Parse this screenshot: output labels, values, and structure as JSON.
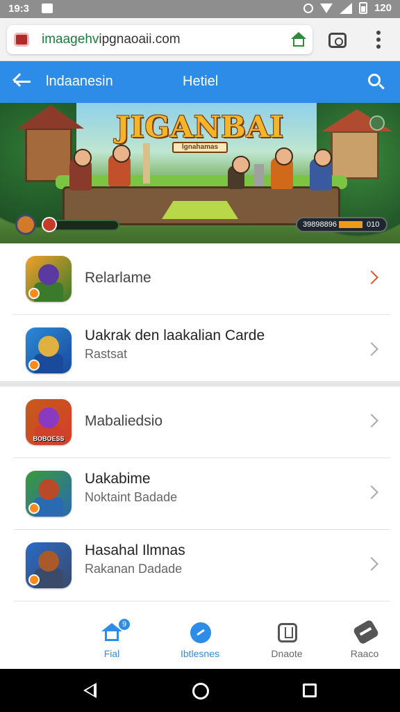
{
  "status_bar": {
    "time": "19:3",
    "battery_text": "120"
  },
  "browser": {
    "url_highlight": "imaagehv",
    "url_rest": "ipgnaoaii.com"
  },
  "app_bar": {
    "left_title": "lndaanesin",
    "center_title": "Hetiel"
  },
  "banner": {
    "game_title": "JIGANBAI",
    "game_subtitle": "lgnahamas",
    "hud_health_fraction": 0.55,
    "hud_health_text": "10",
    "hud_score": "39898896",
    "hud_meter_value": "010"
  },
  "list_section_1": [
    {
      "title": "Relarlame",
      "subtitle": "",
      "thumb_label": "",
      "active": true
    },
    {
      "title": "Uakrak den laakalian Carde",
      "subtitle": "Rastsat",
      "thumb_label": "",
      "active": false
    }
  ],
  "list_section_2": [
    {
      "title": "Mabaliedsio",
      "subtitle": "",
      "thumb_label": "BOBOESS",
      "active": false
    },
    {
      "title": "Uakabime",
      "subtitle": "Noktaint Badade",
      "thumb_label": "",
      "active": false
    },
    {
      "title": "Hasahal Ilmnas",
      "subtitle": "Rakanan Dadade",
      "thumb_label": "",
      "active": false
    }
  ],
  "bottom_nav": {
    "home_label": "Fial",
    "home_badge": "9",
    "explore_label": "Ibtlesnes",
    "store_label": "Dnaote",
    "more_label": "Raaco"
  },
  "colors": {
    "accent": "#2d8ce8",
    "url_green": "#1a7c3a",
    "chevron_active": "#e0502a"
  }
}
